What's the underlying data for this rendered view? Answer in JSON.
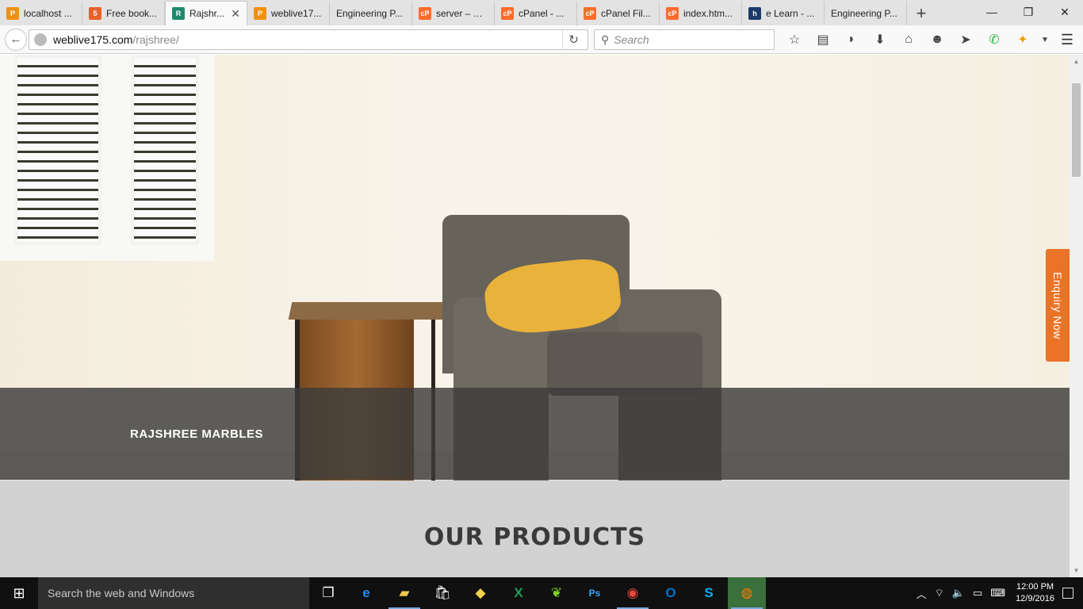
{
  "browser": {
    "tabs": [
      {
        "title": "localhost ...",
        "icon": "pma-icon",
        "icon_color": "#f29111"
      },
      {
        "title": "Free book...",
        "icon": "html-icon",
        "icon_color": "#e96228"
      },
      {
        "title": "Rajshr...",
        "icon": "site-logo-icon",
        "icon_color": "#1f8a6e",
        "active": true
      },
      {
        "title": "weblive17...",
        "icon": "pma-icon",
        "icon_color": "#f29111"
      },
      {
        "title": "Engineering P...",
        "icon": "",
        "icon_color": ""
      },
      {
        "title": "server – W...",
        "icon": "cpanel-icon",
        "icon_color": "#ff6c2c"
      },
      {
        "title": "cPanel - ...",
        "icon": "cpanel-icon",
        "icon_color": "#ff6c2c"
      },
      {
        "title": "cPanel Fil...",
        "icon": "cpanel-icon",
        "icon_color": "#ff6c2c"
      },
      {
        "title": "index.htm...",
        "icon": "cpanel-icon",
        "icon_color": "#ff6c2c"
      },
      {
        "title": "e Learn - ...",
        "icon": "elearn-icon",
        "icon_color": "#1c3a6b"
      },
      {
        "title": "Engineering P...",
        "icon": "",
        "icon_color": ""
      }
    ],
    "url_host": "weblive175.com",
    "url_path": "/rajshree/",
    "search_placeholder": "Search"
  },
  "page": {
    "hero_caption": "RAJSHREE MARBLES",
    "section_title": "OUR PRODUCTS",
    "enquiry_label": "Enquiry Now",
    "accent_color": "#ea7327"
  },
  "taskbar": {
    "search_placeholder": "Search the web and Windows",
    "time": "12:00 PM",
    "date": "12/9/2016",
    "apps": [
      "task-view-icon",
      "edge-icon",
      "file-explorer-icon",
      "store-icon",
      "photos-icon",
      "excel-icon",
      "feather-icon",
      "photoshop-icon",
      "chrome-icon",
      "outlook-icon",
      "skype-icon",
      "firefox-icon"
    ]
  }
}
